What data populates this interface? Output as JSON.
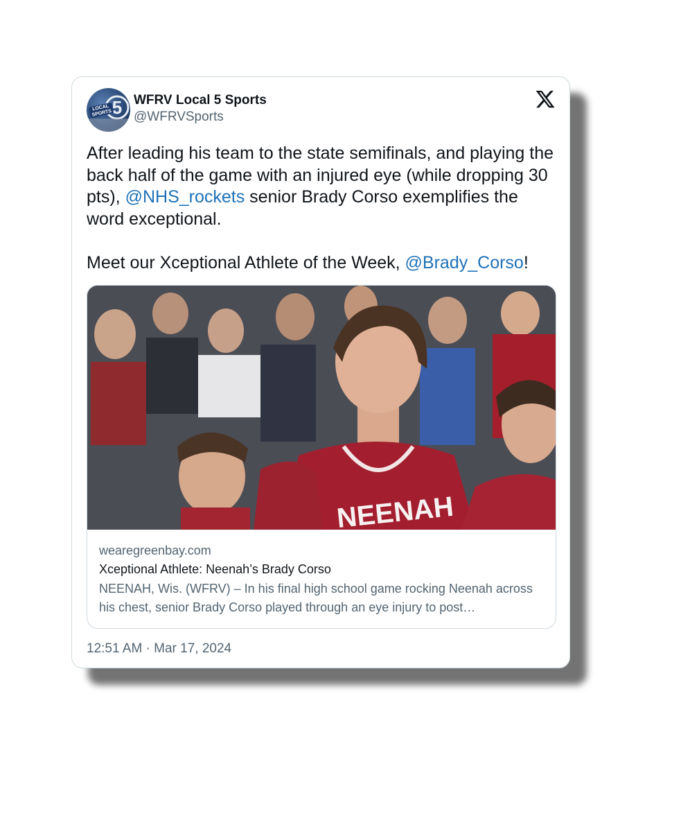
{
  "author": {
    "display_name": "WFRV Local 5 Sports",
    "handle": "@WFRVSports",
    "avatar_text": "LOCAL 5 SPORTS"
  },
  "platform_icon": "x-logo-icon",
  "tweet": {
    "p1_a": "After leading his team to the state semifinals, and playing the back half of the game with an injured eye (while dropping 30 pts), ",
    "p1_mention": "@NHS_rockets",
    "p1_b": " senior Brady Corso exemplifies the word exceptional.",
    "p2_a": "Meet our Xceptional Athlete of the Week, ",
    "p2_mention": "@Brady_Corso",
    "p2_b": "!"
  },
  "link_card": {
    "image_alt": "Neenah basketball player in red jersey looking up, crowd in background",
    "jersey_text": "NEENAH",
    "domain": "wearegreenbay.com",
    "title": "Xceptional Athlete: Neenah’s Brady Corso",
    "description": "NEENAH, Wis. (WFRV) – In his final high school game rocking Neenah across his chest, senior Brady Corso played through an eye injury to post…"
  },
  "timestamp": "12:51 AM · Mar 17, 2024",
  "colors": {
    "mention": "#1d71b8",
    "secondary_text": "#536471",
    "border": "#cfd9de"
  }
}
